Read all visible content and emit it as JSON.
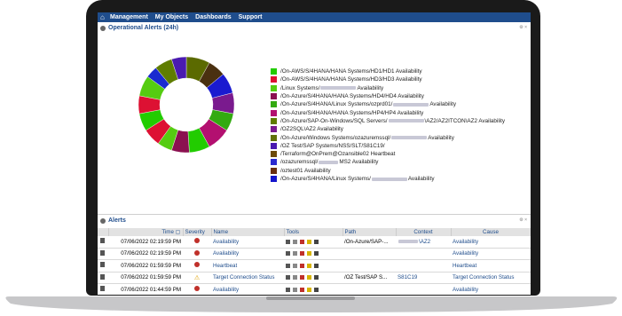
{
  "nav": {
    "items": [
      "Management",
      "My Objects",
      "Dashboards",
      "Support"
    ]
  },
  "alerts_panel": {
    "title": "Operational Alerts (24h)"
  },
  "chart_data": {
    "type": "pie",
    "categories": [
      "/On-AWS/S/4HANA/HANA Systems/HD1/HD1 Availability",
      "/On-AWS/S/4HANA/HANA Systems/HD3/HD3 Availability",
      "/Linux Systems/ Availability",
      "/On-Azure/S/4HANA/HANA Systems/HD4/HD4 Availability",
      "/On-Azure/S/4HANA/Linux Systems/ozprd01/ Availability",
      "/On-Azure/S/4HANA/HANA Systems/HP4/HP4 Availability",
      "/On-Azure/SAP-On-Windows/SQL Servers/ \\AZ2/AZ2ITCON\\AZ2 Availability",
      "/OZ2SQL\\AZ2 Availability",
      "/On-Azure/Windows Systems/ozazuremssql/ Availability",
      "/OZ Test/SAP Systems/NSS/SLT/S81C19/",
      "/Terraform@OnPrem@Ozansible02 Heartbeat",
      "/ozazuremssql/MS2 Availability",
      "/oztest01 Availability",
      "/On-Azure/S/4HANA/Linux Systems/ Availability"
    ],
    "legend_labels": [
      [
        "/On-AWS/S/4HANA/HANA Systems/HD1/HD1 Availability"
      ],
      [
        "/On-AWS/S/4HANA/HANA Systems/HD3/HD3 Availability"
      ],
      [
        "/Linux Systems/",
        "Availability"
      ],
      [
        "/On-Azure/S/4HANA/HANA Systems/HD4/HD4 Availability"
      ],
      [
        "/On-Azure/S/4HANA/Linux Systems/ozprd01/",
        "Availability"
      ],
      [
        "/On-Azure/S/4HANA/HANA Systems/HP4/HP4 Availability"
      ],
      [
        "/On-Azure/SAP-On-Windows/SQL Servers/",
        "\\AZ2/AZ2ITCON\\AZ2 Availability"
      ],
      [
        "/OZ2SQL\\AZ2 Availability"
      ],
      [
        "/On-Azure/Windows Systems/ozazuremssql/",
        "Availability"
      ],
      [
        "/OZ Test/SAP Systems/NSS/SLT/S81C19/"
      ],
      [
        "/Terraform@OnPrem@Ozansible02 Heartbeat"
      ],
      [
        "/ozazuremssql/",
        "MS2 Availability"
      ],
      [
        "/oztest01 Availability"
      ],
      [
        "/On-Azure/S/4HANA/Linux Systems/",
        "Availability"
      ]
    ],
    "colors": [
      "#22cc00",
      "#dd1133",
      "#55cc11",
      "#8b1050",
      "#33aa11",
      "#b31070",
      "#5f7d00",
      "#7a1a8e",
      "#60700a",
      "#4a1ab0",
      "#6b4a0a",
      "#2a2ad0",
      "#6a3010",
      "#1515cc"
    ],
    "slice_colors": [
      "#5b6a00",
      "#4a3010",
      "#1a1ad0",
      "#7a1a8e",
      "#33aa11",
      "#b31070",
      "#22cc00",
      "#8b1050",
      "#55cc11",
      "#dd1133",
      "#22cc00",
      "#dd1133",
      "#55cc11",
      "#1a2ad0",
      "#5f7d00",
      "#4a1ab0"
    ],
    "values": [
      8,
      6,
      7,
      7,
      6,
      8,
      7,
      6,
      5,
      6,
      6,
      6,
      7,
      4,
      6,
      5
    ]
  },
  "alerts_table": {
    "title": "Alerts",
    "columns": [
      "",
      "Time",
      "Severity",
      "Name",
      "Tools",
      "Path",
      "Context",
      "Cause"
    ],
    "rows": [
      {
        "time": "07/06/2022 02:19:59 PM",
        "severity": "critical",
        "name": "Availability",
        "path": "/On-Azure/SAP-...",
        "context": "\\AZ2",
        "cause": "Availability"
      },
      {
        "time": "07/06/2022 02:19:59 PM",
        "severity": "critical",
        "name": "Availability",
        "path": "",
        "context": "",
        "cause": "Availability"
      },
      {
        "time": "07/06/2022 01:59:59 PM",
        "severity": "critical",
        "name": "Heartbeat",
        "path": "",
        "context": "",
        "cause": "Heartbeat"
      },
      {
        "time": "07/06/2022 01:59:59 PM",
        "severity": "warning",
        "name": "Target Connection Status",
        "path": "/OZ Test/SAP S...",
        "context": "S81C19",
        "cause": "Target Connection Status"
      },
      {
        "time": "07/06/2022 01:44:59 PM",
        "severity": "critical",
        "name": "Availability",
        "path": "",
        "context": "",
        "cause": "Availability"
      }
    ]
  }
}
